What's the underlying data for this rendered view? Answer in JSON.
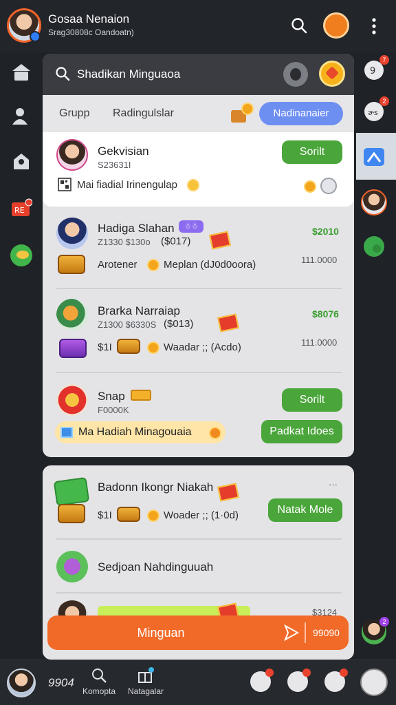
{
  "header": {
    "name": "Gosaa Nenaion",
    "subtitle": "Srag30808c Oandoatn)"
  },
  "search": {
    "text": "Shadikan Minguaoa"
  },
  "tabs": {
    "group": "Grupp",
    "other": "Radingulslar",
    "active": "Nadinanaier"
  },
  "featured": {
    "name": "Gekvisian",
    "code": "S23631I",
    "button": "Sorilt",
    "promo": "Mai fiadial Irinengulap"
  },
  "rows": [
    {
      "name": "Hadiga Slahan",
      "badge": "☃☃",
      "meta": "Z1330 $130o",
      "highlight": "($017)",
      "price": "$2010",
      "label1": "Arotener",
      "label2": "Meplan (dJ0d0oora)",
      "qty": "111.0000"
    },
    {
      "name": "Brarka Narraiap",
      "meta": "Z1300 $6330S",
      "highlight": "($013)",
      "price": "$8076",
      "label1": "$1I",
      "label2": "Waadar ;; (Acdo)",
      "qty": "111.0000"
    },
    {
      "name": "Snap",
      "meta": "F0000K",
      "button1": "Sorilt",
      "button2": "Padkat Idoes",
      "promo": "Ma Hadiah Minagouaia"
    }
  ],
  "card2": {
    "row1_name": "Badonn Ikongr Niakah",
    "row1_more": "···",
    "row1_price": "$1I",
    "row1_label": "Woader ;; (1·0d)",
    "row1_button": "Natak Mole",
    "row2_name": "Sedjoan Nahdinguuah",
    "row3_price": "$3124"
  },
  "action_bar": {
    "label": "Minguan",
    "count": "99090"
  },
  "bottom_nav": {
    "count": "9904",
    "item1": "Komopta",
    "item2": "Natagalar"
  },
  "right_rail": {
    "badge1": "7",
    "badge2": "2",
    "badge3": "2"
  },
  "colors": {
    "accent": "#f26a28",
    "primary": "#6e8ff2",
    "success": "#4aa53a"
  }
}
